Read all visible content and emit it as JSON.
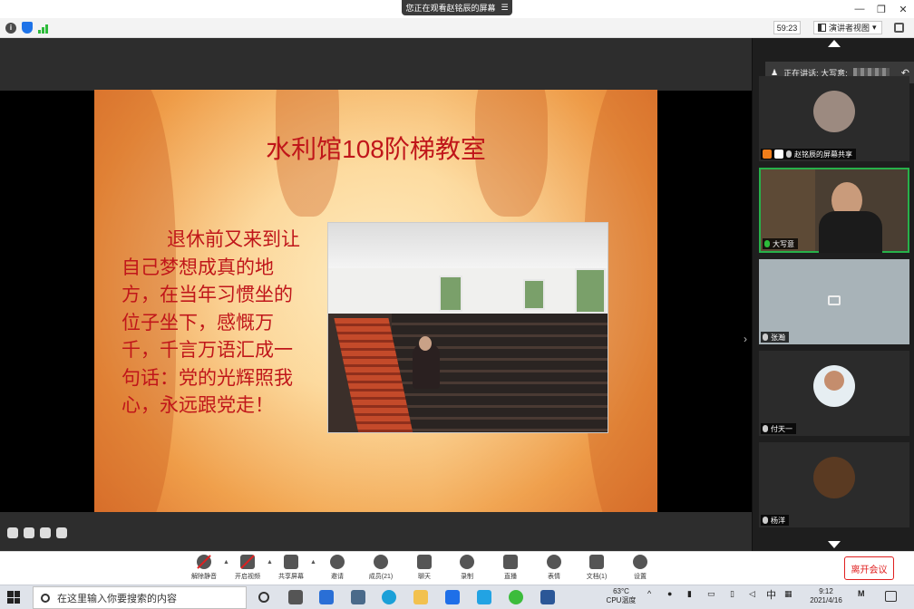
{
  "titlebar": {
    "viewing_text": "您正在观看赵铭辰的屏幕",
    "controls": [
      "—",
      "❐",
      "✕"
    ]
  },
  "infobar": {
    "timer": "59:23",
    "view_mode": "演讲者视图",
    "view_mode_caret": "▾"
  },
  "slide": {
    "title": "水利馆108阶梯教室",
    "body": "退休前又来到让自己梦想成真的地方，在当年习惯坐的位子坐下，感慨万千，千言万语汇成一句话：党的光辉照我心，永远跟党走！"
  },
  "sidepanel": {
    "speaking_label": "正在讲话: 大写意;",
    "participants": [
      {
        "name": "赵铭辰的屏幕共享"
      },
      {
        "name": "大写意"
      },
      {
        "name": "张瀚"
      },
      {
        "name": "付天一"
      },
      {
        "name": "杨洋"
      }
    ]
  },
  "toolbar": {
    "buttons": [
      {
        "label": "解除静音"
      },
      {
        "label": "开启视频"
      },
      {
        "label": "共享屏幕"
      },
      {
        "label": "邀请"
      },
      {
        "label": "成员(21)"
      },
      {
        "label": "聊天"
      },
      {
        "label": "录制"
      },
      {
        "label": "直播"
      },
      {
        "label": "表情"
      },
      {
        "label": "文档(1)"
      },
      {
        "label": "设置"
      }
    ],
    "leave_label": "离开会议"
  },
  "taskbar": {
    "search_placeholder": "在这里输入你要搜索的内容",
    "weather_temp": "63°C",
    "weather_label": "CPU温度",
    "ime": "中",
    "time": "9:12",
    "date": "2021/4/16"
  },
  "colors": {
    "accent_red": "#c0161a",
    "active_green": "#27b14a",
    "leave_red": "#e02020"
  }
}
